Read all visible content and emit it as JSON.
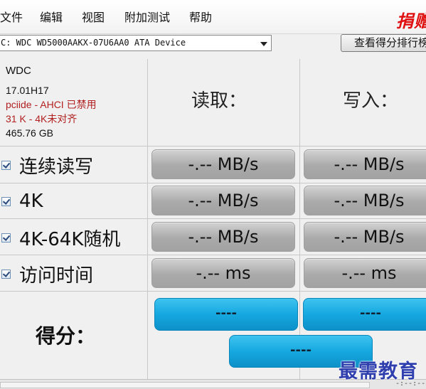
{
  "menu": {
    "items": [
      "文件",
      "编辑",
      "视图",
      "附加测试",
      "帮助"
    ],
    "donate": "捐赠"
  },
  "toolbar": {
    "drive_select_value": "C: WDC WD5000AAKX-07U6AA0 ATA Device",
    "rank_button_label": "查看得分排行榜"
  },
  "drive_info": {
    "vendor": "WDC",
    "firmware": "17.01H17",
    "driver": "pciide - AHCI 已禁用",
    "alignment": "31 K - 4K未对齐",
    "capacity": "465.76 GB"
  },
  "columns": {
    "read": "读取：",
    "write": "写入："
  },
  "tests": [
    {
      "label": "连续读写",
      "checked": true,
      "read": "-.-- MB/s",
      "write": "-.-- MB/s"
    },
    {
      "label": "4K",
      "checked": true,
      "read": "-.-- MB/s",
      "write": "-.-- MB/s"
    },
    {
      "label": "4K-64K随机",
      "checked": true,
      "read": "-.-- MB/s",
      "write": "-.-- MB/s"
    },
    {
      "label": "访问时间",
      "checked": true,
      "read": "-.-- ms",
      "write": "-.-- ms"
    }
  ],
  "score": {
    "label": "得分：",
    "read": "----",
    "write": "----",
    "total": "----"
  },
  "status": {
    "progress_percent": 0,
    "text": "-:--:--"
  },
  "watermark": "最需教育",
  "colors": {
    "accent_blue": "#15a8e0",
    "result_gray": "#aaaaaa",
    "warning_red": "#b22020",
    "donate_red": "#e01010",
    "watermark_blue": "#2f3fae"
  },
  "icons": {
    "checkbox": "checkbox-checked-icon",
    "dropdown": "chevron-down-icon"
  }
}
